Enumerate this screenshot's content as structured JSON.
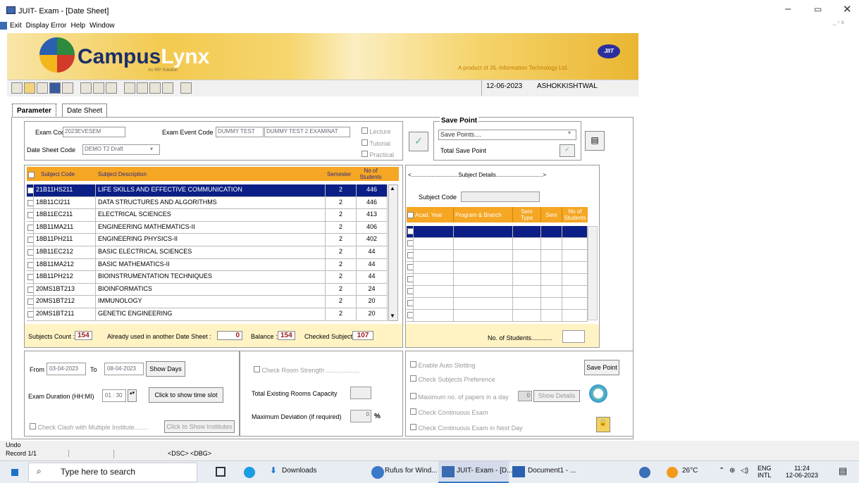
{
  "window": {
    "title": "JUIT- Exam - [Date Sheet]",
    "menu": [
      "Exit",
      "Display Error",
      "Help",
      "Window"
    ]
  },
  "banner": {
    "brand_a": "Campus",
    "brand_b": "Lynx",
    "sub": "An IRP Solution",
    "tagline": "A product of JIL-Information Technology Ltd.",
    "logo": "JIIT"
  },
  "toolbar": {
    "date": "12-06-2023",
    "user": "ASHOKKISHTWAL"
  },
  "tabs": [
    "Parameter",
    "Date Sheet"
  ],
  "params": {
    "exam_code_label": "Exam Code",
    "exam_code": "2023EVESEM",
    "event_label": "Exam Event Code",
    "event_code": "DUMMY TEST",
    "event_desc": "DUMMY TEST 2 EXAMINAT",
    "sheet_label": "Date Sheet Code",
    "sheet_code": "DEMO T2 Draft",
    "lecture": "Lecture",
    "tutorial": "Tutorial",
    "practical": "Practical"
  },
  "save_point": {
    "title": "Save Point",
    "select": "Save Points....",
    "total": "Total Save Point"
  },
  "subjects": {
    "headers": [
      "Subject Code",
      "Subject Description",
      "Semester",
      "No of Students"
    ],
    "rows": [
      [
        "21B11HS211",
        "LIFE SKILLS AND EFFECTIVE COMMUNICATION",
        "2",
        "446"
      ],
      [
        "18B11CI211",
        "DATA STRUCTURES AND ALGORITHMS",
        "2",
        "446"
      ],
      [
        "18B11EC211",
        "ELECTRICAL SCIENCES",
        "2",
        "413"
      ],
      [
        "18B11MA211",
        "ENGINEERING MATHEMATICS-II",
        "2",
        "406"
      ],
      [
        "18B11PH211",
        "ENGINEERING PHYSICS-II",
        "2",
        "402"
      ],
      [
        "18B11EC212",
        "BASIC ELECTRICAL SCIENCES",
        "2",
        "44"
      ],
      [
        "18B11MA212",
        "BASIC MATHEMATICS-II",
        "2",
        "44"
      ],
      [
        "18B11PH212",
        "BIOINSTRUMENTATION TECHNIQUES",
        "2",
        "44"
      ],
      [
        "20MS1BT213",
        "BIOINFORMATICS",
        "2",
        "24"
      ],
      [
        "20MS1BT212",
        "IMMUNOLOGY",
        "2",
        "20"
      ],
      [
        "20MS1BT211",
        "GENETIC ENGINEERING",
        "2",
        "20"
      ]
    ],
    "count_label": "Subjects Count :",
    "count": "154",
    "used_label": "Already used in another Date Sheet :",
    "used": "0",
    "balance_label": "Balance :",
    "balance": "154",
    "checked_label": "Checked Subjects :",
    "checked": "107"
  },
  "details": {
    "title": "<..............................Subject Details..............................>",
    "code_label": "Subject Code",
    "headers": [
      "Acad. Year",
      "Program & Branch",
      "Sem Type",
      "Sem",
      "No of Students"
    ],
    "students_label": "No. of Students............"
  },
  "dates": {
    "from_label": "From",
    "from": "03-04-2023",
    "to_label": "To",
    "to": "08-04-2023",
    "show_days": "Show Days",
    "duration_label": "Exam Duration (HH:MI)",
    "duration": "01 : 30",
    "time_slot": "Click to show time slot",
    "clash": "Check Clash with Multiple Institute........",
    "show_inst": "Click to Show Institutes"
  },
  "rooms": {
    "strength": "Check Room Strength ...................",
    "capacity": "Total Existing Rooms Capacity",
    "deviation": "Maximum Deviation (if required)",
    "deviation_val": "0",
    "pct": "%"
  },
  "slotting": {
    "auto": "Enable Auto Slotting",
    "pref": "Check Subjects Preference",
    "max": "Maximum no. of papers in a day",
    "max_val": "0",
    "show": "Show Details",
    "cont": "Check Continuous Exam",
    "nday": "Check Continuous Exam in Next Day",
    "save_btn": "Save Point"
  },
  "status": {
    "undo": "Undo",
    "record": "Record 1/1",
    "keys": "<DSC> <DBG>"
  },
  "taskbar": {
    "search": "Type here to search",
    "downloads": "Downloads",
    "rufus": "Rufus for Wind...",
    "exam": "JUIT- Exam - [D...",
    "doc": "Document1 - ...",
    "temp": "26°C",
    "lang": "ENG",
    "lang2": "INTL",
    "time": "11:24",
    "date": "12-06-2023"
  }
}
